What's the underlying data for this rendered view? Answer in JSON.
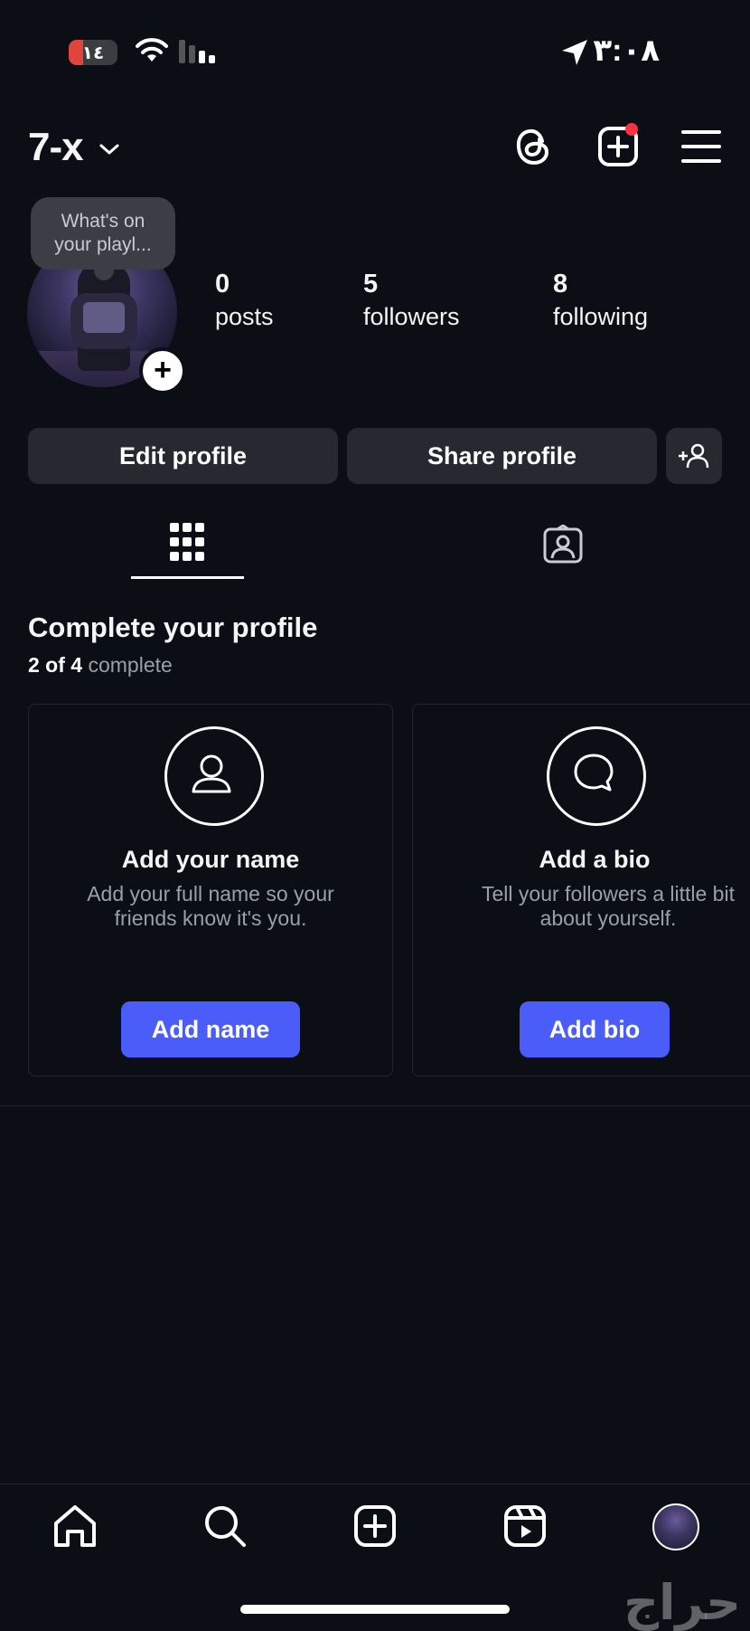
{
  "status_bar": {
    "battery": "١٤",
    "time": "٣:٠٨"
  },
  "header": {
    "username": "7-x"
  },
  "note_bubble": {
    "text_line1": "What's on",
    "text_line2": "your playl..."
  },
  "stats": [
    {
      "number": "0",
      "label": "posts"
    },
    {
      "number": "5",
      "label": "followers"
    },
    {
      "number": "8",
      "label": "following"
    }
  ],
  "actions": {
    "edit_profile": "Edit profile",
    "share_profile": "Share profile"
  },
  "section": {
    "title": "Complete your profile",
    "progress_count": "2 of 4",
    "progress_label": "complete"
  },
  "cards": [
    {
      "icon": "user-icon",
      "title": "Add your name",
      "desc_line1": "Add your full name so your",
      "desc_line2": "friends know it's you.",
      "button": "Add name"
    },
    {
      "icon": "speech-bubble-icon",
      "title": "Add a bio",
      "desc_line1": "Tell your followers a little bit",
      "desc_line2": "about yourself.",
      "button": "Add bio"
    }
  ],
  "watermark": "حراج",
  "colors": {
    "background": "#0b0e14",
    "button_gray": "#262a30",
    "accent_blue": "#4a5df9",
    "notification_red": "#ff3040"
  }
}
